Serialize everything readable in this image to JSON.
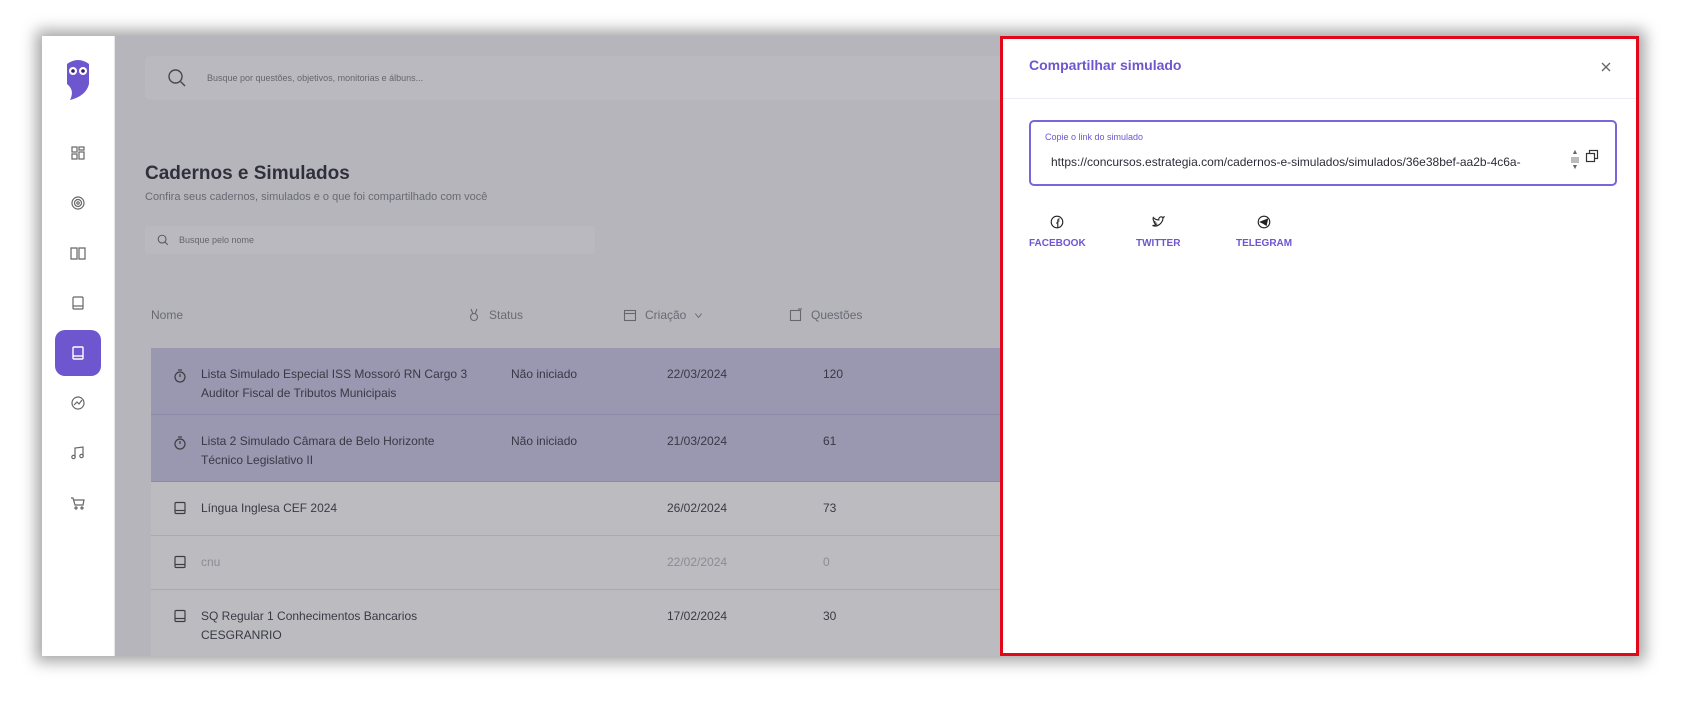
{
  "sidebar": {
    "items": [
      {
        "name": "dashboard",
        "icon": "grid-icon",
        "active": false
      },
      {
        "name": "objectives",
        "icon": "target-icon",
        "active": false
      },
      {
        "name": "courses",
        "icon": "book-open-icon",
        "active": false
      },
      {
        "name": "notebooks",
        "icon": "notebook-icon",
        "active": false
      },
      {
        "name": "simulados",
        "icon": "notebook-icon",
        "active": true
      },
      {
        "name": "performance",
        "icon": "chart-circle-icon",
        "active": false
      },
      {
        "name": "audio",
        "icon": "music-icon",
        "active": false
      },
      {
        "name": "store",
        "icon": "cart-icon",
        "active": false
      }
    ]
  },
  "header": {
    "search_placeholder": "Busque por questões, objetivos, monitorias e álbuns..."
  },
  "page": {
    "title": "Cadernos e Simulados",
    "subtitle": "Confira seus cadernos, simulados e o que foi compartilhado com você",
    "name_search_placeholder": "Busque pelo nome"
  },
  "table": {
    "columns": {
      "name": "Nome",
      "status": "Status",
      "created": "Criação",
      "questions": "Questões"
    },
    "rows": [
      {
        "icon": "stopwatch-icon",
        "name": "Lista Simulado Especial ISS Mossoró RN Cargo 3 Auditor Fiscal de Tributos Municipais",
        "status": "Não iniciado",
        "date": "22/03/2024",
        "questions": "120",
        "selected": true
      },
      {
        "icon": "stopwatch-icon",
        "name": "Lista 2 Simulado Câmara de Belo Horizonte Técnico Legislativo II",
        "status": "Não iniciado",
        "date": "21/03/2024",
        "questions": "61",
        "selected": true
      },
      {
        "icon": "notebook-icon",
        "name": "Língua Inglesa CEF 2024",
        "status": "",
        "date": "26/02/2024",
        "questions": "73",
        "selected": false
      },
      {
        "icon": "notebook-icon",
        "name": "cnu",
        "status": "",
        "date": "22/02/2024",
        "questions": "0",
        "selected": false
      },
      {
        "icon": "notebook-icon",
        "name": "SQ Regular 1 Conhecimentos Bancarios CESGRANRIO",
        "status": "",
        "date": "17/02/2024",
        "questions": "30",
        "selected": false
      }
    ]
  },
  "modal": {
    "title": "Compartilhar simulado",
    "link_label": "Copie o link do simulado",
    "link_value": "https://concursos.estrategia.com/cadernos-e-simulados/simulados/36e38bef-aa2b-4c6a-",
    "share": {
      "facebook": "FACEBOOK",
      "twitter": "TWITTER",
      "telegram": "TELEGRAM"
    }
  },
  "colors": {
    "accent": "#6e56cf",
    "highlight_border": "#e1081a",
    "selected_row": "#c9c3e6"
  }
}
